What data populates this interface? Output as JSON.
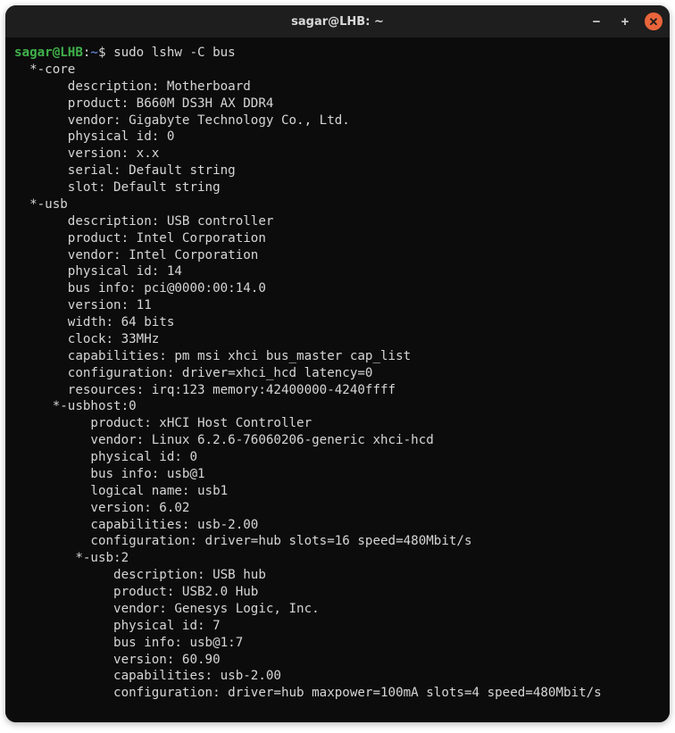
{
  "window": {
    "title": "sagar@LHB: ~"
  },
  "prompt": {
    "user_host": "sagar@LHB",
    "sep1": ":",
    "path": "~",
    "sep2": "$ "
  },
  "command": "sudo lshw -C bus",
  "output_lines": [
    "  *-core",
    "       description: Motherboard",
    "       product: B660M DS3H AX DDR4",
    "       vendor: Gigabyte Technology Co., Ltd.",
    "       physical id: 0",
    "       version: x.x",
    "       serial: Default string",
    "       slot: Default string",
    "  *-usb",
    "       description: USB controller",
    "       product: Intel Corporation",
    "       vendor: Intel Corporation",
    "       physical id: 14",
    "       bus info: pci@0000:00:14.0",
    "       version: 11",
    "       width: 64 bits",
    "       clock: 33MHz",
    "       capabilities: pm msi xhci bus_master cap_list",
    "       configuration: driver=xhci_hcd latency=0",
    "       resources: irq:123 memory:42400000-4240ffff",
    "     *-usbhost:0",
    "          product: xHCI Host Controller",
    "          vendor: Linux 6.2.6-76060206-generic xhci-hcd",
    "          physical id: 0",
    "          bus info: usb@1",
    "          logical name: usb1",
    "          version: 6.02",
    "          capabilities: usb-2.00",
    "          configuration: driver=hub slots=16 speed=480Mbit/s",
    "        *-usb:2",
    "             description: USB hub",
    "             product: USB2.0 Hub",
    "             vendor: Genesys Logic, Inc.",
    "             physical id: 7",
    "             bus info: usb@1:7",
    "             version: 60.90",
    "             capabilities: usb-2.00",
    "             configuration: driver=hub maxpower=100mA slots=4 speed=480Mbit/s"
  ]
}
